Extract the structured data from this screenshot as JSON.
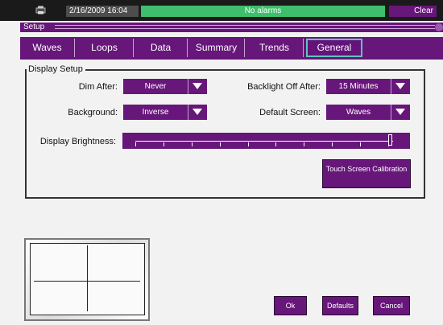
{
  "status": {
    "datetime": "2/16/2009 16:04",
    "alarm_text": "No alarms",
    "clear_label": "Clear",
    "icon": "printer-icon"
  },
  "header": {
    "title": "Setup"
  },
  "tabs": [
    {
      "label": "Waves"
    },
    {
      "label": "Loops"
    },
    {
      "label": "Data"
    },
    {
      "label": "Summary"
    },
    {
      "label": "Trends"
    },
    {
      "label": "General",
      "active": true
    }
  ],
  "display_setup": {
    "title": "Display Setup",
    "dim_after": {
      "label": "Dim After:",
      "value": "Never"
    },
    "background": {
      "label": "Background:",
      "value": "Inverse"
    },
    "backlight_off_after": {
      "label": "Backlight Off After:",
      "value": "15 Minutes"
    },
    "default_screen": {
      "label": "Default Screen:",
      "value": "Waves"
    },
    "brightness": {
      "label": "Display Brightness:",
      "level": 1.0,
      "tick_count": 10
    },
    "touch_calibration_label": "Touch Screen Calibration"
  },
  "actions": {
    "ok": "Ok",
    "defaults": "Defaults",
    "cancel": "Cancel"
  },
  "colors": {
    "primary": "#67167a",
    "status_ok": "#3fbf6c",
    "active_tab_border": "#5ac8b8",
    "background": "#f2f2f2"
  }
}
